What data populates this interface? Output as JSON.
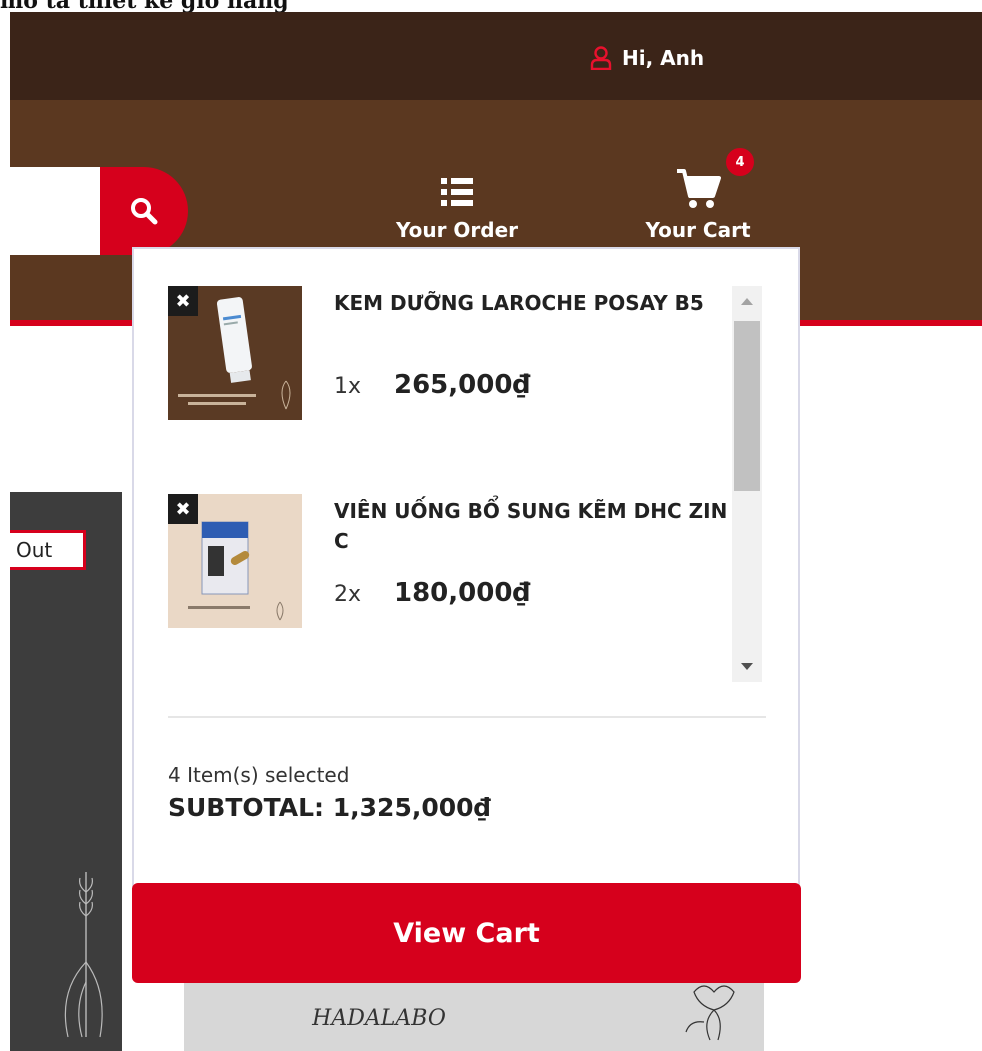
{
  "page": {
    "title": "mô tả thiết kế giỏ hàng"
  },
  "header": {
    "greeting": "Hi, Anh",
    "search_placeholder": "",
    "order_label": "Your Order",
    "cart_label": "Your Cart",
    "cart_count": "4"
  },
  "cart": {
    "items": [
      {
        "name": "KEM DƯỠNG LAROCHE POSAY B5",
        "qty": "1x",
        "price": "265,000₫",
        "thumb_bg": "#5a3a24",
        "thumb_icon": "cream-tube"
      },
      {
        "name": "VIÊN UỐNG BỔ SUNG KẼM DHC ZIN C",
        "qty": "2x",
        "price": "180,000₫",
        "thumb_bg": "#ead8c6",
        "thumb_icon": "supplement-pack"
      }
    ],
    "selected_count": "4 Item(s) selected",
    "subtotal": "SUBTOTAL: 1,325,000₫",
    "view_cart_label": "View Cart",
    "remove_glyph": "✖"
  },
  "background": {
    "out_label": "Out",
    "brand_card": "HADALABO"
  },
  "colors": {
    "accent_red": "#d6001c",
    "top_bar": "#3b2418",
    "main_bar": "#5b3820"
  }
}
